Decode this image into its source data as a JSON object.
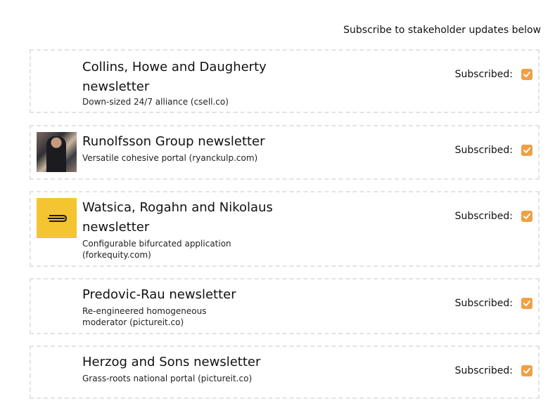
{
  "header": {
    "text": "Subscribe to stakeholder updates below"
  },
  "subscribed_label": "Subscribed:",
  "accent_color": "#f0a044",
  "newsletters": [
    {
      "title": "Collins, Howe and Daugherty newsletter",
      "description": "Down-sized 24/7 alliance (csell.co)",
      "subscribed": true,
      "image": "none"
    },
    {
      "title": "Runolfsson Group newsletter",
      "description": "Versatile cohesive portal (ryanckulp.com)",
      "subscribed": true,
      "image": "person-photo"
    },
    {
      "title": "Watsica, Rogahn and Nikolaus newsletter",
      "description": "Configurable bifurcated application (forkequity.com)",
      "subscribed": true,
      "image": "yellow-logo"
    },
    {
      "title": "Predovic-Rau newsletter",
      "description": "Re-engineered homogeneous moderator (pictureit.co)",
      "subscribed": true,
      "image": "none"
    },
    {
      "title": "Herzog and Sons newsletter",
      "description": "Grass-roots national portal (pictureit.co)",
      "subscribed": true,
      "image": "none"
    }
  ]
}
